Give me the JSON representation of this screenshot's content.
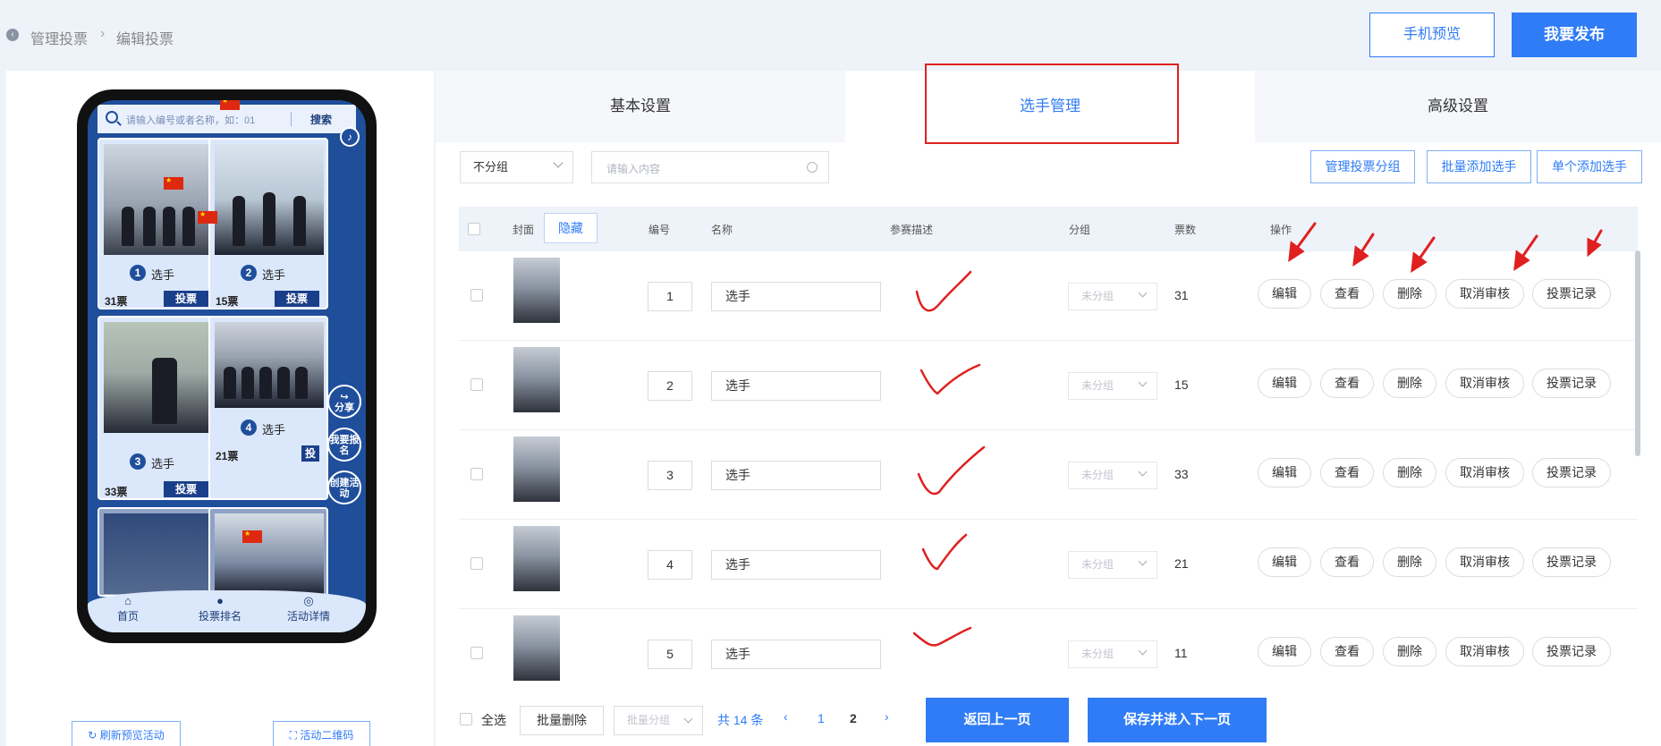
{
  "breadcrumb": {
    "parent": "管理投票",
    "current": "编辑投票"
  },
  "header": {
    "preview_label": "手机预览",
    "publish_label": "我要发布"
  },
  "phone": {
    "search_placeholder": "请输入编号或者名称，如：01",
    "search_button": "搜索",
    "cards": [
      {
        "num": "1",
        "name": "选手",
        "votes": "31票",
        "vote_button": "投票"
      },
      {
        "num": "2",
        "name": "选手",
        "votes": "15票",
        "vote_button": "投票"
      },
      {
        "num": "3",
        "name": "选手",
        "votes": "33票",
        "vote_button": "投票"
      },
      {
        "num": "4",
        "name": "选手",
        "votes": "21票",
        "vote_button": "投"
      }
    ],
    "float_buttons": {
      "share": "分享",
      "signup": "我要报名",
      "create": "创建活动"
    },
    "nav": [
      {
        "label": "首页"
      },
      {
        "label": "投票排名"
      },
      {
        "label": "活动详情"
      }
    ]
  },
  "left_buttons": {
    "refresh": "刷新预览活动",
    "qrcode": "活动二维码"
  },
  "tabs": [
    {
      "label": "基本设置"
    },
    {
      "label": "选手管理"
    },
    {
      "label": "高级设置"
    }
  ],
  "toolbar": {
    "group_select": "不分组",
    "search_placeholder": "请输入内容",
    "manage_groups": "管理投票分组",
    "bulk_add": "批量添加选手",
    "single_add": "单个添加选手"
  },
  "table": {
    "headers": {
      "cover": "封面",
      "hide": "隐藏",
      "id": "编号",
      "name": "名称",
      "desc": "参赛描述",
      "group": "分组",
      "votes": "票数",
      "actions": "操作"
    },
    "group_placeholder": "未分组",
    "action_labels": {
      "edit": "编辑",
      "view": "查看",
      "delete": "删除",
      "cancel_review": "取消审核",
      "vote_log": "投票记录"
    },
    "rows": [
      {
        "id": "1",
        "name": "选手",
        "votes": "31"
      },
      {
        "id": "2",
        "name": "选手",
        "votes": "15"
      },
      {
        "id": "3",
        "name": "选手",
        "votes": "33"
      },
      {
        "id": "4",
        "name": "选手",
        "votes": "21"
      },
      {
        "id": "5",
        "name": "选手",
        "votes": "11"
      }
    ]
  },
  "footer": {
    "select_all": "全选",
    "bulk_delete": "批量删除",
    "bulk_group": "批量分组",
    "total": "共 14 条",
    "pages": [
      "1",
      "2"
    ],
    "current_page": "2",
    "prev_step": "返回上一页",
    "next_step": "保存并进入下一页"
  },
  "colors": {
    "accent": "#2f7cf6",
    "annotation": "#e02020",
    "phone_theme": "#1f4e9b"
  },
  "icons": {
    "back": "chevron-left-icon",
    "search": "search-icon",
    "music": "music-icon",
    "refresh": "refresh-icon",
    "qrcode": "scan-icon",
    "prev": "chevron-left-icon",
    "next": "chevron-right-icon"
  }
}
